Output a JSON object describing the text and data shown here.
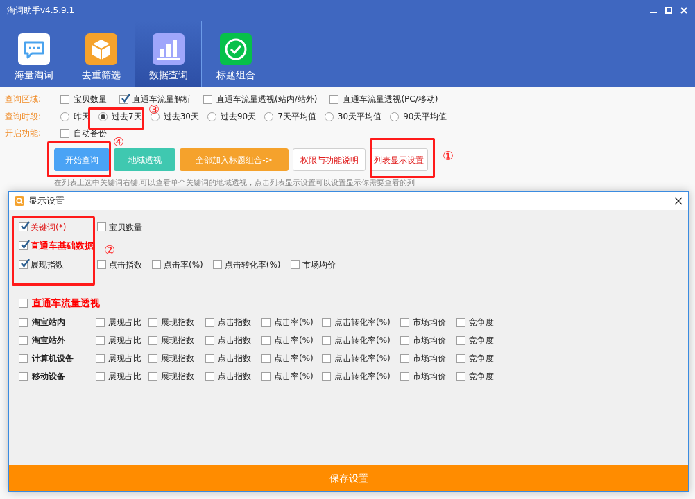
{
  "window": {
    "title": "淘词助手v4.5.9.1"
  },
  "nav_tabs": [
    {
      "label": "海量淘词",
      "selected": false,
      "kind": "chat"
    },
    {
      "label": "去重筛选",
      "selected": false,
      "kind": "box"
    },
    {
      "label": "数据查询",
      "selected": true,
      "kind": "chart"
    },
    {
      "label": "标题组合",
      "selected": false,
      "kind": "check"
    }
  ],
  "query_area": {
    "label": "查询区域:",
    "options": [
      {
        "label": "宝贝数量",
        "checked": false
      },
      {
        "label": "直通车流量解析",
        "checked": true
      },
      {
        "label": "直通车流量透视(站内/站外)",
        "checked": false
      },
      {
        "label": "直通车流量透视(PC/移动)",
        "checked": false
      }
    ]
  },
  "query_period": {
    "label": "查询时段:",
    "options": [
      {
        "label": "昨天",
        "selected": false
      },
      {
        "label": "过去7天",
        "selected": true
      },
      {
        "label": "过去30天",
        "selected": false
      },
      {
        "label": "过去90天",
        "selected": false
      },
      {
        "label": "7天平均值",
        "selected": false
      },
      {
        "label": "30天平均值",
        "selected": false
      },
      {
        "label": "90天平均值",
        "selected": false
      }
    ]
  },
  "features": {
    "label": "开启功能:",
    "options": [
      {
        "label": "自动备份",
        "checked": false
      }
    ]
  },
  "buttons": [
    {
      "label": "开始查询",
      "kind": "blue"
    },
    {
      "label": "地域透视",
      "kind": "teal"
    },
    {
      "label": "全部加入标题组合->",
      "kind": "orange"
    },
    {
      "label": "权限与功能说明",
      "kind": "outline"
    },
    {
      "label": "列表显示设置",
      "kind": "outline"
    }
  ],
  "hint": "在列表上选中关键词右键,可以查看单个关键词的地域透视，点击列表显示设置可以设置显示你需要查看的列",
  "dialog": {
    "title": "显示设置",
    "basic_rows": [
      {
        "label": "关键词(*)",
        "checked": true,
        "kind": "required",
        "others": [
          {
            "label": "宝贝数量",
            "checked": false
          }
        ]
      },
      {
        "label": "直通车基础数据",
        "checked": true,
        "kind": "header",
        "others": []
      },
      {
        "label": "展现指数",
        "checked": true,
        "kind": "plain",
        "others": [
          {
            "label": "点击指数",
            "checked": false
          },
          {
            "label": "点击率(%)",
            "checked": false
          },
          {
            "label": "点击转化率(%)",
            "checked": false
          },
          {
            "label": "市场均价",
            "checked": false
          }
        ]
      }
    ],
    "flow_header": {
      "label": "直通车流量透视",
      "checked": false
    },
    "flow_rows": [
      {
        "label": "淘宝站内",
        "checked": false,
        "options": [
          {
            "label": "展现占比",
            "checked": false
          },
          {
            "label": "展现指数",
            "checked": false
          },
          {
            "label": "点击指数",
            "checked": false
          },
          {
            "label": "点击率(%)",
            "checked": false
          },
          {
            "label": "点击转化率(%)",
            "checked": false
          },
          {
            "label": "市场均价",
            "checked": false
          },
          {
            "label": "竞争度",
            "checked": false
          }
        ]
      },
      {
        "label": "淘宝站外",
        "checked": false,
        "options": [
          {
            "label": "展现占比",
            "checked": false
          },
          {
            "label": "展现指数",
            "checked": false
          },
          {
            "label": "点击指数",
            "checked": false
          },
          {
            "label": "点击率(%)",
            "checked": false
          },
          {
            "label": "点击转化率(%)",
            "checked": false
          },
          {
            "label": "市场均价",
            "checked": false
          },
          {
            "label": "竞争度",
            "checked": false
          }
        ]
      },
      {
        "label": "计算机设备",
        "checked": false,
        "options": [
          {
            "label": "展现占比",
            "checked": false
          },
          {
            "label": "展现指数",
            "checked": false
          },
          {
            "label": "点击指数",
            "checked": false
          },
          {
            "label": "点击率(%)",
            "checked": false
          },
          {
            "label": "点击转化率(%)",
            "checked": false
          },
          {
            "label": "市场均价",
            "checked": false
          },
          {
            "label": "竞争度",
            "checked": false
          }
        ]
      },
      {
        "label": "移动设备",
        "checked": false,
        "options": [
          {
            "label": "展现占比",
            "checked": false
          },
          {
            "label": "展现指数",
            "checked": false
          },
          {
            "label": "点击指数",
            "checked": false
          },
          {
            "label": "点击率(%)",
            "checked": false
          },
          {
            "label": "点击转化率(%)",
            "checked": false
          },
          {
            "label": "市场均价",
            "checked": false
          },
          {
            "label": "竞争度",
            "checked": false
          }
        ]
      }
    ],
    "save_button": "保存设置"
  },
  "annotations": [
    "①",
    "②",
    "③",
    "④"
  ]
}
